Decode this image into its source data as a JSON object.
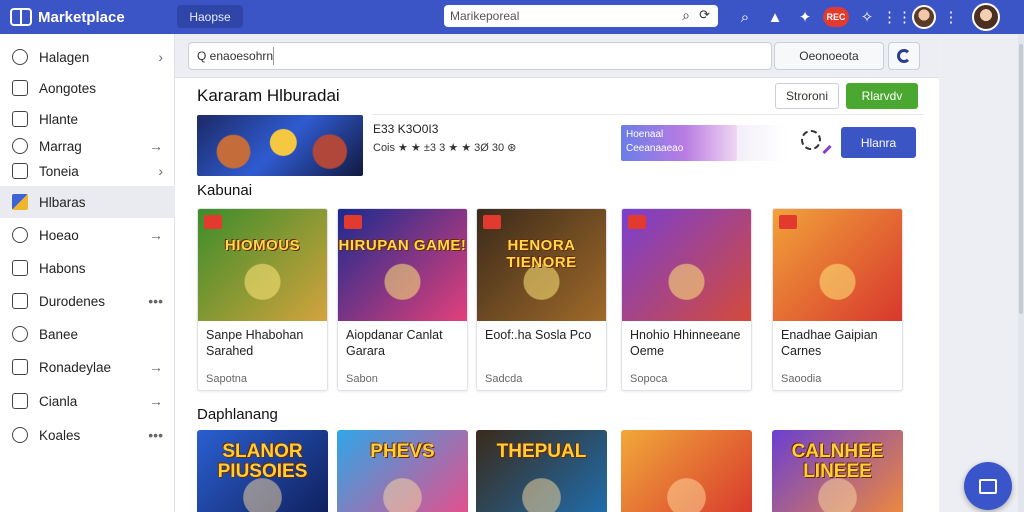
{
  "app": {
    "title": "Marketplace"
  },
  "topbar": {
    "tab_label": "Haopse",
    "search_value": "Marikeporeal",
    "icons": [
      "search-icon",
      "bell-icon",
      "gift-icon",
      "record-icon",
      "pin-icon",
      "grid-icon",
      "avatar",
      "more-icon"
    ],
    "record_label": "REC"
  },
  "sidebar": {
    "items": [
      {
        "label": "Halagen",
        "icon": "user-icon",
        "trail": "›"
      },
      {
        "label": "Aongotes",
        "icon": "image-icon",
        "trail": ""
      },
      {
        "label": "Hlante",
        "icon": "file-icon",
        "trail": ""
      },
      {
        "label": "Marrag",
        "icon": "chat-icon",
        "trail": "→"
      },
      {
        "label": "Toneia",
        "icon": "document-icon",
        "trail": "›"
      },
      {
        "label": "Hlbaras",
        "icon": "library-icon",
        "trail": ""
      },
      {
        "label": "Hoeao",
        "icon": "info-icon",
        "trail": "→"
      },
      {
        "label": "Habons",
        "icon": "download-icon",
        "trail": ""
      },
      {
        "label": "Durodenes",
        "icon": "puzzle-icon",
        "trail": "•••"
      },
      {
        "label": "Banee",
        "icon": "eye-icon",
        "trail": ""
      },
      {
        "label": "Ronadeylae",
        "icon": "search-icon",
        "trail": "→"
      },
      {
        "label": "Cianla",
        "icon": "share-icon",
        "trail": "→"
      },
      {
        "label": "Koales",
        "icon": "settings-icon",
        "trail": "•••"
      }
    ],
    "active_index": 5
  },
  "filterbar": {
    "search_value": "Q  enaoesohrn",
    "sort_label": "Oeonoeota"
  },
  "header": {
    "title": "Kararam Hlburadai",
    "secondary_button": "Stroroni",
    "primary_button": "Rlarvdv"
  },
  "featured": {
    "stats": "E33 K3O0I3",
    "rating_text": "Cois ★ ★ ±3 3  ★ ★ 3Ø 30 ⊛",
    "promo_line1": "Hoenaal",
    "promo_line2": "Ceeanaaeao",
    "action_button": "Hlanra"
  },
  "sections": [
    {
      "title": "Kabunai",
      "cards": [
        {
          "thumb_text": "HIOMOUS",
          "title": "Sanpe Hhabohan Sarahed",
          "subtitle": "Sapotna",
          "colors": [
            "#3b8d2a",
            "#d4a33d"
          ]
        },
        {
          "thumb_text": "HIRUPAN GAME!",
          "title": "Aiopdanar Canlat Garara",
          "subtitle": "Sabon",
          "colors": [
            "#1a2a8f",
            "#e3407a"
          ]
        },
        {
          "thumb_text": "HENORA TIENORE",
          "title": "Eoof:.ha Sosla Pco",
          "subtitle": "Sadcda",
          "colors": [
            "#3b2a1a",
            "#a06a2a"
          ]
        },
        {
          "thumb_text": "",
          "title": "Hnohio Hhinneeane Oeme",
          "subtitle": "Sopoca",
          "colors": [
            "#7a3fd1",
            "#d44a3a"
          ]
        },
        {
          "thumb_text": "",
          "title": "Enadhae Gaipian Carnes",
          "subtitle": "Saoodia",
          "colors": [
            "#f1a23a",
            "#d8372d"
          ]
        }
      ]
    },
    {
      "title": "Daphlanang",
      "cards": [
        {
          "thumb_text": "SLANOR PIUSOIES",
          "colors": [
            "#2a5fd1",
            "#0f1f5a"
          ]
        },
        {
          "thumb_text": "PHEVS",
          "colors": [
            "#2fa6e8",
            "#e94d8a"
          ]
        },
        {
          "thumb_text": "THEPUAL",
          "colors": [
            "#3a2a1a",
            "#1f6fb0"
          ]
        },
        {
          "thumb_text": "",
          "colors": [
            "#f1a83a",
            "#d8372d"
          ]
        },
        {
          "thumb_text": "CALNHEE LINEEE",
          "colors": [
            "#6a3fd1",
            "#f18a3a"
          ]
        }
      ]
    }
  ],
  "fab": {
    "icon": "folder-icon"
  }
}
